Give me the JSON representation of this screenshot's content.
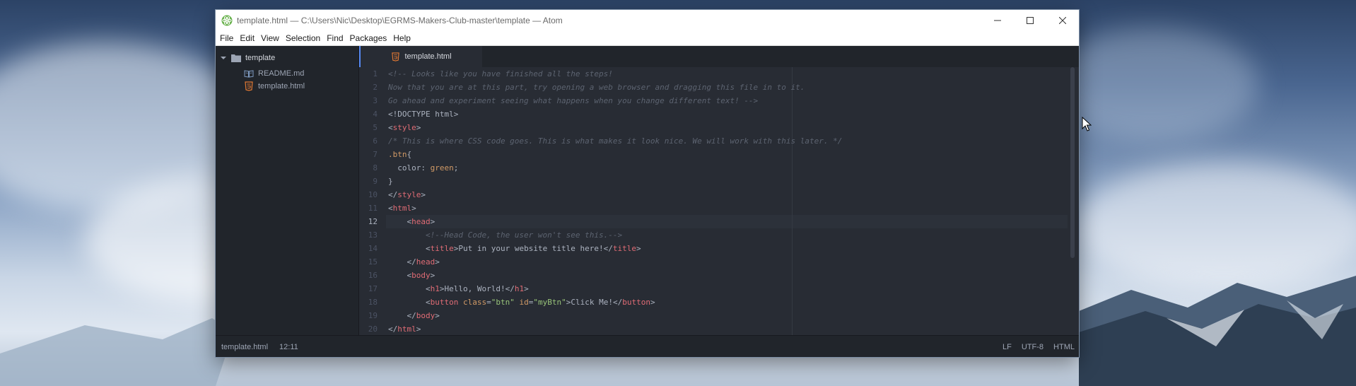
{
  "window": {
    "title": "template.html — C:\\Users\\Nic\\Desktop\\EGRMS-Makers-Club-master\\template — Atom"
  },
  "menu": [
    "File",
    "Edit",
    "View",
    "Selection",
    "Find",
    "Packages",
    "Help"
  ],
  "tree": {
    "root": "template",
    "files": [
      {
        "name": "README.md",
        "icon": "book-icon"
      },
      {
        "name": "template.html",
        "icon": "html5-icon"
      }
    ]
  },
  "tabs": [
    {
      "label": "template.html",
      "icon": "html5-icon",
      "active": true
    }
  ],
  "editor": {
    "active_line": 12,
    "lines": [
      {
        "n": "1",
        "text": "<!-- Looks like you have finished all the steps!"
      },
      {
        "n": "2",
        "text": "Now that you are at this part, try opening a web browser and dragging this file in to it."
      },
      {
        "n": "3",
        "text": "Go ahead and experiment seeing what happens when you change different text! -->"
      },
      {
        "n": "4",
        "text": "<!DOCTYPE html>"
      },
      {
        "n": "5",
        "text": "<style>"
      },
      {
        "n": "6",
        "text": "/* This is where CSS code goes. This is what makes it look nice. We will work with this later. */"
      },
      {
        "n": "7",
        "text": ".btn{"
      },
      {
        "n": "8",
        "text": "  color: green;"
      },
      {
        "n": "9",
        "text": "}"
      },
      {
        "n": "10",
        "text": "</style>"
      },
      {
        "n": "11",
        "text": "<html>"
      },
      {
        "n": "12",
        "text": "    <head>"
      },
      {
        "n": "13",
        "text": "        <!--Head Code, the user won't see this.-->"
      },
      {
        "n": "14",
        "text": "        <title>Put in your website title here!</title>"
      },
      {
        "n": "15",
        "text": "    </head>"
      },
      {
        "n": "16",
        "text": "    <body>"
      },
      {
        "n": "17",
        "text": "        <h1>Hello, World!</h1>"
      },
      {
        "n": "18",
        "text": "        <button class=\"btn\" id=\"myBtn\">Click Me!</button>"
      },
      {
        "n": "19",
        "text": "    </body>"
      },
      {
        "n": "20",
        "text": "</html>"
      }
    ]
  },
  "status": {
    "file": "template.html",
    "cursor": "12:11",
    "line_ending": "LF",
    "encoding": "UTF-8",
    "grammar": "HTML"
  },
  "colors": {
    "editor_bg": "#282c34",
    "panel_bg": "#21252b",
    "accent": "#568af2",
    "tag": "#e06c75",
    "string": "#98c379",
    "attr": "#d19a66",
    "comment": "#5c6370"
  }
}
